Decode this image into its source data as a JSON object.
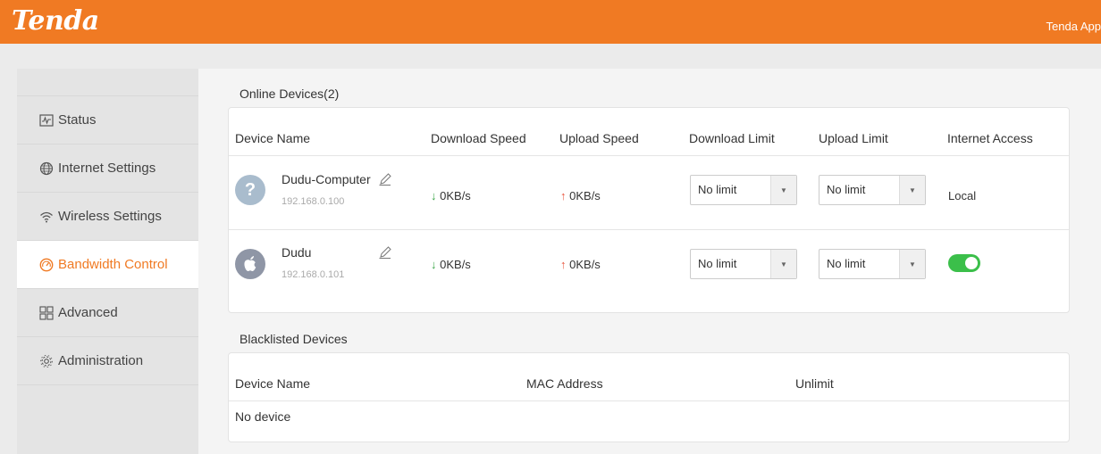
{
  "header": {
    "logo": "Tenda",
    "app_link": "Tenda App"
  },
  "sidebar": {
    "items": [
      {
        "label": "Status",
        "icon": "status-icon"
      },
      {
        "label": "Internet Settings",
        "icon": "globe-icon"
      },
      {
        "label": "Wireless Settings",
        "icon": "wifi-icon"
      },
      {
        "label": "Bandwidth Control",
        "icon": "gauge-icon",
        "active": true
      },
      {
        "label": "Advanced",
        "icon": "grid-icon"
      },
      {
        "label": "Administration",
        "icon": "gear-icon"
      }
    ]
  },
  "online": {
    "title": "Online Devices(2)",
    "headers": {
      "device_name": "Device Name",
      "download_speed": "Download Speed",
      "upload_speed": "Upload Speed",
      "download_limit": "Download Limit",
      "upload_limit": "Upload Limit",
      "internet_access": "Internet Access"
    },
    "devices": [
      {
        "name": "Dudu-Computer",
        "ip": "192.168.0.100",
        "avatar": "?",
        "download": "0KB/s",
        "upload": "0KB/s",
        "download_limit": "No limit",
        "upload_limit": "No limit",
        "access": "Local"
      },
      {
        "name": "Dudu",
        "ip": "192.168.0.101",
        "avatar": "apple-icon",
        "download": "0KB/s",
        "upload": "0KB/s",
        "download_limit": "No limit",
        "upload_limit": "No limit",
        "access_toggle": true
      }
    ]
  },
  "blacklist": {
    "title": "Blacklisted Devices",
    "headers": {
      "device_name": "Device Name",
      "mac": "MAC Address",
      "unlimit": "Unlimit"
    },
    "empty_text": "No device"
  },
  "symbols": {
    "down_arrow": "↓",
    "up_arrow": "↑",
    "caret": "▼"
  },
  "colors": {
    "brand": "#f07a23",
    "download": "#3aa548",
    "upload": "#e8543c",
    "toggle_on": "#3bbf4a"
  }
}
